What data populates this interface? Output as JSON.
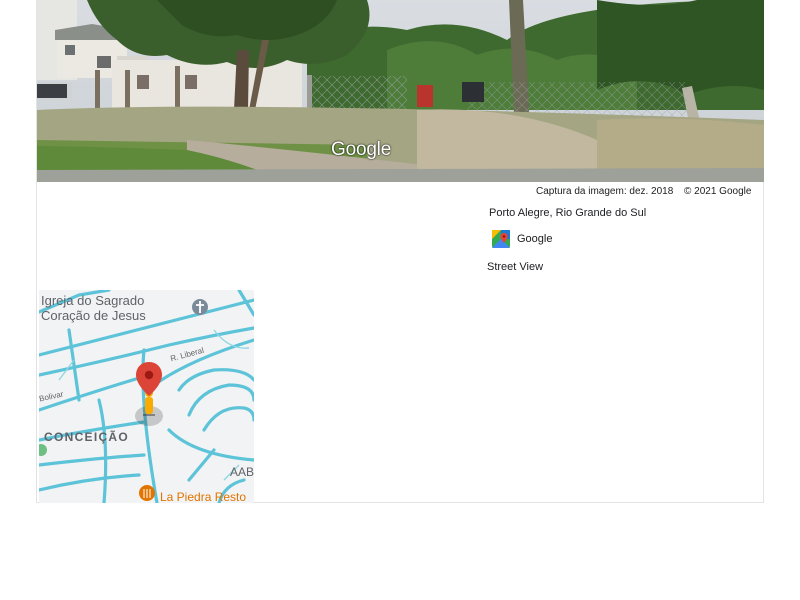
{
  "street_view": {
    "watermark": "Google",
    "capture_label": "Captura da imagem: dez. 2018",
    "copyright": "© 2021 Google"
  },
  "location": "Porto Alegre, Rio Grande do Sul",
  "maps_link": {
    "label": "Google",
    "icon": "google-maps-icon"
  },
  "view_mode": "Street View",
  "minimap": {
    "church_line1": "Igreja do Sagrado",
    "church_line2": "Coração de Jesus",
    "street_liberal": "R. Liberal",
    "street_bolivar": "Bolivar",
    "neighborhood": "CONCEIÇÃO",
    "poi_partial": "AAB",
    "restaurant": "La Piedra Resto",
    "pin_color": "#db4437",
    "pegman_color": "#f9ab00",
    "road_color": "#5cc3d8"
  }
}
